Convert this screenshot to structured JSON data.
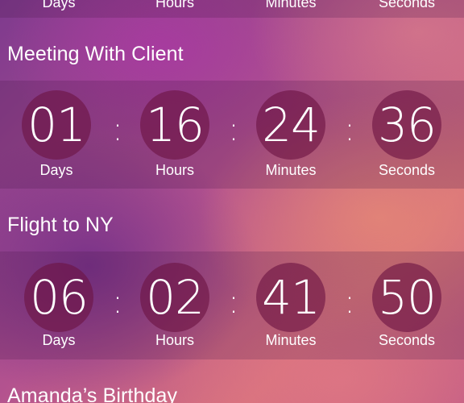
{
  "top_partial_row": {
    "labels": [
      "Days",
      "Hours",
      "Minutes",
      "Seconds"
    ]
  },
  "events": [
    {
      "title": "Meeting With Client",
      "units": [
        {
          "value": "01",
          "label": "Days"
        },
        {
          "value": "16",
          "label": "Hours"
        },
        {
          "value": "24",
          "label": "Minutes"
        },
        {
          "value": "36",
          "label": "Seconds"
        }
      ]
    },
    {
      "title": "Flight to NY",
      "units": [
        {
          "value": "06",
          "label": "Days"
        },
        {
          "value": "02",
          "label": "Hours"
        },
        {
          "value": "41",
          "label": "Minutes"
        },
        {
          "value": "50",
          "label": "Seconds"
        }
      ]
    },
    {
      "title": "Amanda’s Birthday"
    }
  ],
  "separator": ":",
  "colors": {
    "circle": "#6c1442",
    "text": "#ffffff"
  }
}
